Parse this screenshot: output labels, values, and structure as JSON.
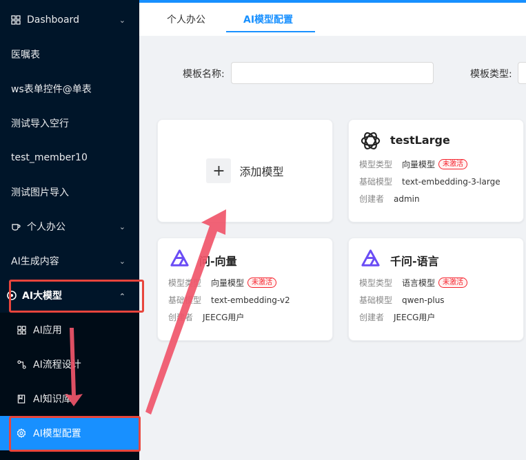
{
  "sidebar": {
    "items": [
      {
        "label": "Dashboard",
        "icon": "grid-icon"
      },
      {
        "label": "医嘱表"
      },
      {
        "label": "ws表单控件@单表"
      },
      {
        "label": "测试导入空行"
      },
      {
        "label": "test_member10"
      },
      {
        "label": "测试图片导入"
      },
      {
        "label": "个人办公",
        "icon": "coffee-icon"
      },
      {
        "label": "AI生成内容"
      },
      {
        "label": "AI大模型",
        "icon": "openai-icon"
      },
      {
        "label": "AI应用",
        "icon": "appstore-icon"
      },
      {
        "label": "AI流程设计",
        "icon": "flow-icon"
      },
      {
        "label": "AI知识库",
        "icon": "book-icon"
      },
      {
        "label": "AI模型配置",
        "icon": "setting-icon"
      }
    ],
    "active_label": "AI模型配置"
  },
  "tabs": [
    {
      "label": "个人办公"
    },
    {
      "label": "AI模型配置"
    }
  ],
  "filters": {
    "name_label": "模板名称:",
    "name_value": "",
    "type_label": "模板类型:",
    "type_value": ""
  },
  "add_card": {
    "label": "添加模型"
  },
  "models": [
    {
      "name": "testLarge",
      "logo": "openai-logo",
      "type_key": "模型类型",
      "type": "向量模型",
      "status": "未激活",
      "base_key": "基础模型",
      "base": "text-embedding-3-large",
      "creator_key": "创建者",
      "creator": "admin"
    },
    {
      "name": "问-向量",
      "logo": "qwen-logo",
      "type_key": "模型类型",
      "type": "向量模型",
      "status": "未激活",
      "base_key": "基础模型",
      "base": "text-embedding-v2",
      "creator_key": "创建者",
      "creator": "JEECG用户"
    },
    {
      "name": "千问-语言",
      "logo": "qwen-logo",
      "type_key": "模型类型",
      "type": "语言模型",
      "status": "未激活",
      "base_key": "基础模型",
      "base": "qwen-plus",
      "creator_key": "创建者",
      "creator": "JEECG用户"
    }
  ],
  "colors": {
    "sidebar_bg": "#001529",
    "accent": "#1890ff",
    "annotation_red": "#e8453c",
    "badge_red": "#f5222d"
  }
}
